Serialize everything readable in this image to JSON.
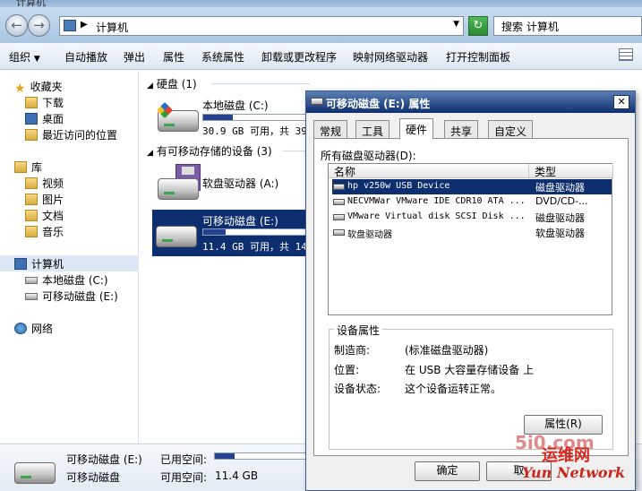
{
  "window": {
    "title": "计算机"
  },
  "address": {
    "crumb": "计算机",
    "search_placeholder": "搜索 计算机"
  },
  "toolbar": {
    "organize": "组织",
    "autoplay": "自动播放",
    "eject": "弹出",
    "properties": "属性",
    "system_properties": "系统属性",
    "uninstall": "卸载或更改程序",
    "map_drive": "映射网络驱动器",
    "control_panel": "打开控制面板"
  },
  "nav": {
    "favorites": "收藏夹",
    "downloads": "下载",
    "desktop": "桌面",
    "recent": "最近访问的位置",
    "libraries": "库",
    "videos": "视频",
    "pictures": "图片",
    "documents": "文档",
    "music": "音乐",
    "computer": "计算机",
    "local_disk": "本地磁盘 (C:)",
    "removable": "可移动磁盘 (E:)",
    "network": "网络"
  },
  "content": {
    "hdd_group": "硬盘 (1)",
    "removable_group": "有可移动存储的设备 (3)",
    "local_disk": {
      "name": "本地磁盘 (C:)",
      "info": "30.9 GB 可用，共 39",
      "used_fraction": 0.25
    },
    "floppy": {
      "name": "软盘驱动器 (A:)"
    },
    "removable": {
      "name": "可移动磁盘 (E:)",
      "info": "11.4 GB 可用，共 14",
      "used_fraction": 0.2
    }
  },
  "details": {
    "name": "可移动磁盘 (E:)",
    "type": "可移动磁盘",
    "used_label": "已用空间:",
    "free_label": "可用空间:",
    "free_value": "11.4 GB",
    "used_fraction": 0.2
  },
  "dialog": {
    "title": "可移动磁盘 (E:) 属性",
    "tabs": [
      "常规",
      "工具",
      "硬件",
      "共享",
      "自定义"
    ],
    "all_drives_label": "所有磁盘驱动器(D):",
    "columns": {
      "name": "名称",
      "type": "类型"
    },
    "drives": [
      {
        "name": "hp v250w USB Device",
        "type": "磁盘驱动器"
      },
      {
        "name": "NECVMWar VMware IDE CDR10 ATA ...",
        "type": "DVD/CD-..."
      },
      {
        "name": "VMware Virtual disk SCSI Disk ...",
        "type": "磁盘驱动器"
      },
      {
        "name": "软盘驱动器",
        "type": "软盘驱动器"
      }
    ],
    "device_props_title": "设备属性",
    "manufacturer_label": "制造商:",
    "manufacturer_value": "(标准磁盘驱动器)",
    "location_label": "位置:",
    "location_value": "在 USB 大容量存储设备 上",
    "status_label": "设备状态:",
    "status_value": "这个设备运转正常。",
    "properties_button": "属性(R)",
    "ok_button": "确定",
    "cancel_button": "取"
  },
  "watermark": {
    "site": "5i0.com",
    "brand": "运维网",
    "tag": "Yun Network"
  }
}
